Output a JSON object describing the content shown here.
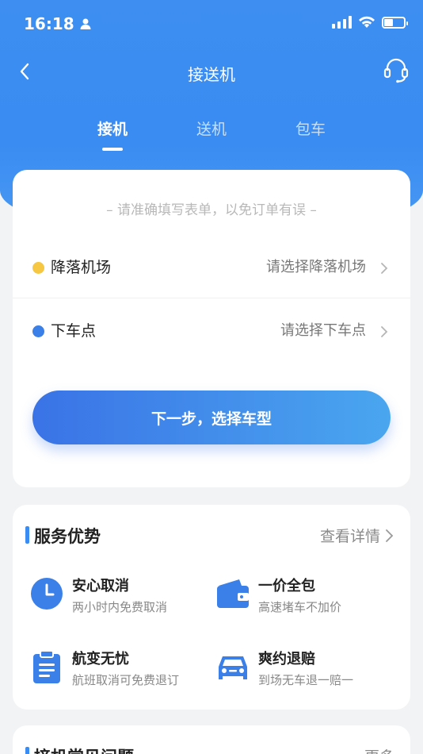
{
  "status_bar": {
    "time": "16:18",
    "battery_level": 0.45
  },
  "nav": {
    "title": "接送机"
  },
  "tabs": [
    {
      "label": "接机",
      "active": true
    },
    {
      "label": "送机",
      "active": false
    },
    {
      "label": "包车",
      "active": false
    }
  ],
  "form": {
    "notice": "– 请准确填写表单，以免订单有误 –",
    "rows": [
      {
        "label": "降落机场",
        "value": "请选择降落机场",
        "dot_color": "#f5c742"
      },
      {
        "label": "下车点",
        "value": "请选择下车点",
        "dot_color": "#3a80e8"
      }
    ],
    "next_button": "下一步，选择车型"
  },
  "advantages": {
    "title": "服务优势",
    "more": "查看详情",
    "items": [
      {
        "title": "安心取消",
        "desc": "两小时内免费取消",
        "icon": "clock-icon"
      },
      {
        "title": "一价全包",
        "desc": "高速堵车不加价",
        "icon": "wallet-icon"
      },
      {
        "title": "航变无忧",
        "desc": "航班取消可免费退订",
        "icon": "clipboard-icon"
      },
      {
        "title": "爽约退赔",
        "desc": "到场无车退一赔一",
        "icon": "car-icon"
      }
    ]
  },
  "faq": {
    "title": "接机常见问题",
    "more": "更多"
  },
  "colors": {
    "primary": "#3a8cf2",
    "accent_yellow": "#f5c742"
  }
}
